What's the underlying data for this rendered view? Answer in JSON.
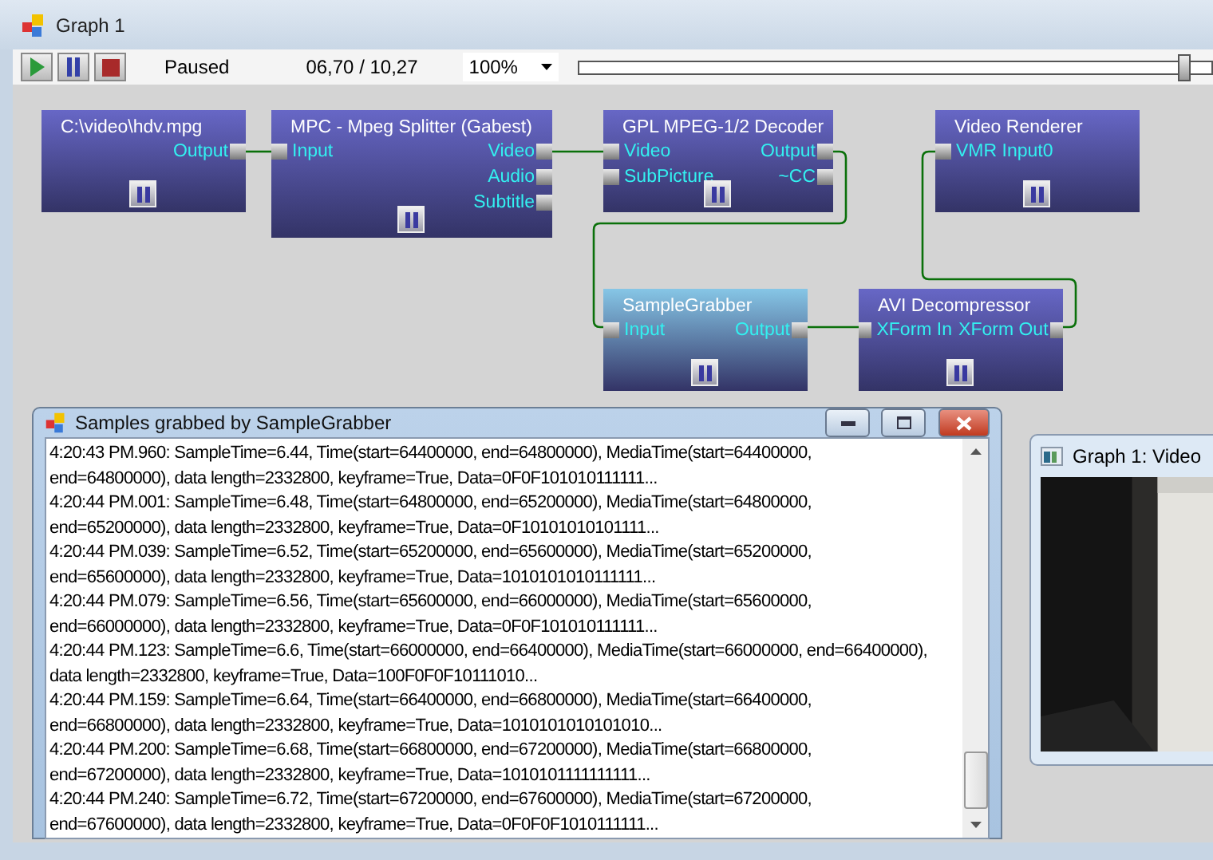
{
  "window": {
    "title": "Graph 1"
  },
  "toolbar": {
    "buttons": [
      {
        "kind": "play"
      },
      {
        "kind": "pause"
      },
      {
        "kind": "stop"
      }
    ],
    "state": "Paused",
    "position": "06,70 / 10,27",
    "zoom": "100%",
    "seek": {
      "level": 0.955
    }
  },
  "nodes": [
    {
      "title": "C:\\video\\hdv.mpg",
      "selected": false,
      "outputs": [
        "Output"
      ]
    },
    {
      "title": "MPC - Mpeg Splitter (Gabest)",
      "selected": false,
      "inputs": [
        "Input"
      ],
      "outputs": [
        "Video",
        "Audio",
        "Subtitle"
      ]
    },
    {
      "title": "GPL MPEG-1/2 Decoder",
      "selected": false,
      "inputs": [
        "Video",
        "SubPicture"
      ],
      "outputs": [
        "Output",
        "~CC"
      ]
    },
    {
      "title": "Video Renderer",
      "selected": false,
      "inputs": [
        "VMR Input0"
      ]
    },
    {
      "title": "SampleGrabber",
      "selected": true,
      "inputs": [
        "Input"
      ],
      "outputs": [
        "Output"
      ]
    },
    {
      "title": "AVI Decompressor",
      "selected": false,
      "inputs": [
        "XForm In"
      ],
      "outputs": [
        "XForm Out"
      ]
    }
  ],
  "log_window": {
    "title": "Samples grabbed by SampleGrabber",
    "lines": [
      "4:20:43 PM.960: SampleTime=6.44, Time(start=64400000, end=64800000), MediaTime(start=64400000,",
      "end=64800000), data length=2332800, keyframe=True, Data=0F0F101010111111...",
      "4:20:44 PM.001: SampleTime=6.48, Time(start=64800000, end=65200000), MediaTime(start=64800000,",
      "end=65200000), data length=2332800, keyframe=True, Data=0F10101010101111...",
      "4:20:44 PM.039: SampleTime=6.52, Time(start=65200000, end=65600000), MediaTime(start=65200000,",
      "end=65600000), data length=2332800, keyframe=True, Data=1010101010111111...",
      "4:20:44 PM.079: SampleTime=6.56, Time(start=65600000, end=66000000), MediaTime(start=65600000,",
      "end=66000000), data length=2332800, keyframe=True, Data=0F0F101010111111...",
      "4:20:44 PM.123: SampleTime=6.6, Time(start=66000000, end=66400000), MediaTime(start=66000000, end=66400000),",
      "data length=2332800, keyframe=True, Data=100F0F0F10111010...",
      "4:20:44 PM.159: SampleTime=6.64, Time(start=66400000, end=66800000), MediaTime(start=66400000,",
      "end=66800000), data length=2332800, keyframe=True, Data=1010101010101010...",
      "4:20:44 PM.200: SampleTime=6.68, Time(start=66800000, end=67200000), MediaTime(start=66800000,",
      "end=67200000), data length=2332800, keyframe=True, Data=1010101111111111...",
      "4:20:44 PM.240: SampleTime=6.72, Time(start=67200000, end=67600000), MediaTime(start=67200000,",
      "end=67600000), data length=2332800, keyframe=True, Data=0F0F0F1010111111..."
    ]
  },
  "video_window": {
    "title": "Graph 1: Video"
  }
}
